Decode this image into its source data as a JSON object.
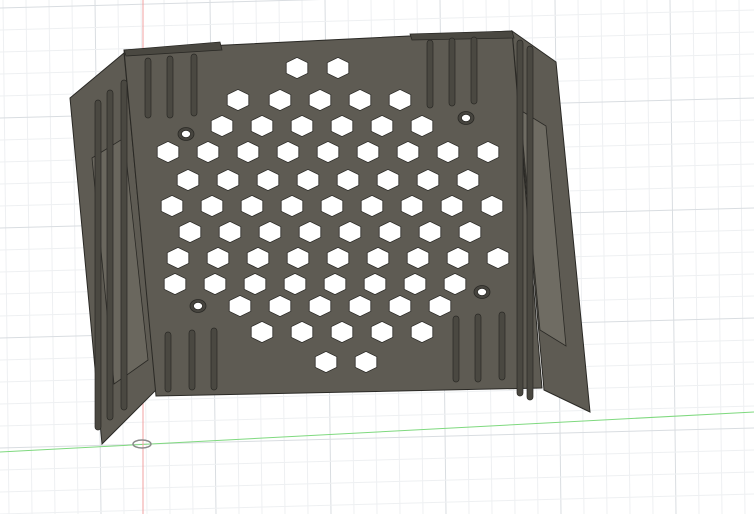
{
  "viewport": {
    "background": "#ffffff",
    "grid_minor_color": "#eef0f2",
    "grid_major_color": "#d9dde1",
    "axis_x_color": "#7fd97f",
    "axis_y_color": "#f0a0a0"
  },
  "part": {
    "type": "ventilated-bracket",
    "body_color": "#5e5b53",
    "body_dark_color": "#4a4841",
    "edge_color": "#2a2925",
    "hole_color": "#ffffff",
    "hex_pattern": true,
    "mounting_holes": 4
  },
  "icons": {
    "origin": "origin-marker-icon"
  }
}
